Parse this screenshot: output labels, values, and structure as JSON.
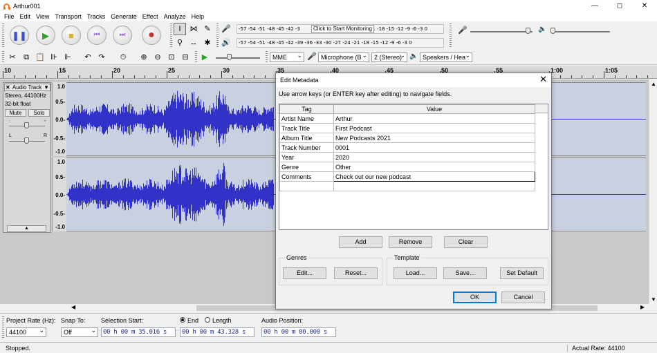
{
  "window": {
    "title": "Arthur001",
    "controls": {
      "minimize": "—",
      "maximize": "◻",
      "close": "✕"
    }
  },
  "menu": [
    "File",
    "Edit",
    "View",
    "Transport",
    "Tracks",
    "Generate",
    "Effect",
    "Analyze",
    "Help"
  ],
  "toolbar": {
    "record_meter_scale": "-57 -54 -51 -48 -45 -42 -3",
    "record_meter_scale_tail": "21 -18 -15 -12 -9 -6 -3 0",
    "monitor_hint": "Click to Start Monitoring",
    "play_meter_scale": "-57 -54 -51 -48 -45 -42 -39 -36 -33 -30 -27 -24 -21 -18 -15 -12 -9 -6 -3 0",
    "host": "MME",
    "recording_device": "Microphone (B",
    "channels": "2 (Stereo)",
    "playback_device": "Speakers / Hea"
  },
  "ruler": {
    "labels": [
      "10",
      "15",
      "20",
      "25",
      "30",
      "35",
      "40",
      "45",
      "50",
      "55",
      "1:00",
      "1:05"
    ]
  },
  "track": {
    "name": "Audio Track",
    "format": "Stereo, 44100Hz",
    "bit_depth": "32-bit float",
    "mute_label": "Mute",
    "solo_label": "Solo",
    "gain_left": "L",
    "gain_right": "R",
    "pan_left": "L",
    "pan_right": "R",
    "scale_top": [
      "1.0",
      "0.5-",
      "0.0-",
      "-0.5-",
      "-1.0"
    ],
    "scale_bottom": [
      "1.0",
      "0.5-",
      "0.0-",
      "-0.5-",
      "-1.0"
    ]
  },
  "selection": {
    "project_rate_label": "Project Rate (Hz):",
    "project_rate": "44100",
    "snap_label": "Snap To:",
    "snap_value": "Off",
    "selection_start_label": "Selection Start:",
    "start_time": "00 h 00 m 35.016 s",
    "end_label": "End",
    "length_label": "Length",
    "end_time": "00 h 00 m 43.328 s",
    "audio_position_label": "Audio Position:",
    "audio_position": "00 h 00 m 00.000 s"
  },
  "status": {
    "left": "Stopped.",
    "right": "Actual Rate: 44100"
  },
  "dialog": {
    "title": "Edit Metadata",
    "hint": "Use arrow keys (or ENTER key after editing) to navigate fields.",
    "columns": {
      "tag": "Tag",
      "value": "Value"
    },
    "rows": [
      {
        "tag": "Artist Name",
        "value": "Arthur"
      },
      {
        "tag": "Track Title",
        "value": "First Podcast"
      },
      {
        "tag": "Album Title",
        "value": "New Podcasts 2021"
      },
      {
        "tag": "Track Number",
        "value": "0001"
      },
      {
        "tag": "Year",
        "value": "2020"
      },
      {
        "tag": "Genre",
        "value": "Other"
      },
      {
        "tag": "Comments",
        "value": "Check out our new podcast"
      }
    ],
    "add_label": "Add",
    "remove_label": "Remove",
    "clear_label": "Clear",
    "genres_label": "Genres",
    "edit_label": "Edit...",
    "reset_label": "Reset...",
    "template_label": "Template",
    "load_label": "Load...",
    "save_label": "Save...",
    "set_default_label": "Set Default",
    "ok_label": "OK",
    "cancel_label": "Cancel"
  },
  "colors": {
    "waveform": "#3232c8",
    "waveform_bg": "#c9d0e0",
    "accent": "#0078d7",
    "record": "#c83232",
    "play": "#2ea02e"
  },
  "icons": [
    "audacity-logo",
    "pause-icon",
    "play-icon",
    "stop-icon",
    "skip-start-icon",
    "skip-end-icon",
    "record-icon",
    "selection-tool-icon",
    "envelope-tool-icon",
    "draw-tool-icon",
    "zoom-tool-icon",
    "timeshift-tool-icon",
    "multi-tool-icon",
    "microphone-icon",
    "speaker-icon",
    "undo-icon",
    "redo-icon"
  ]
}
